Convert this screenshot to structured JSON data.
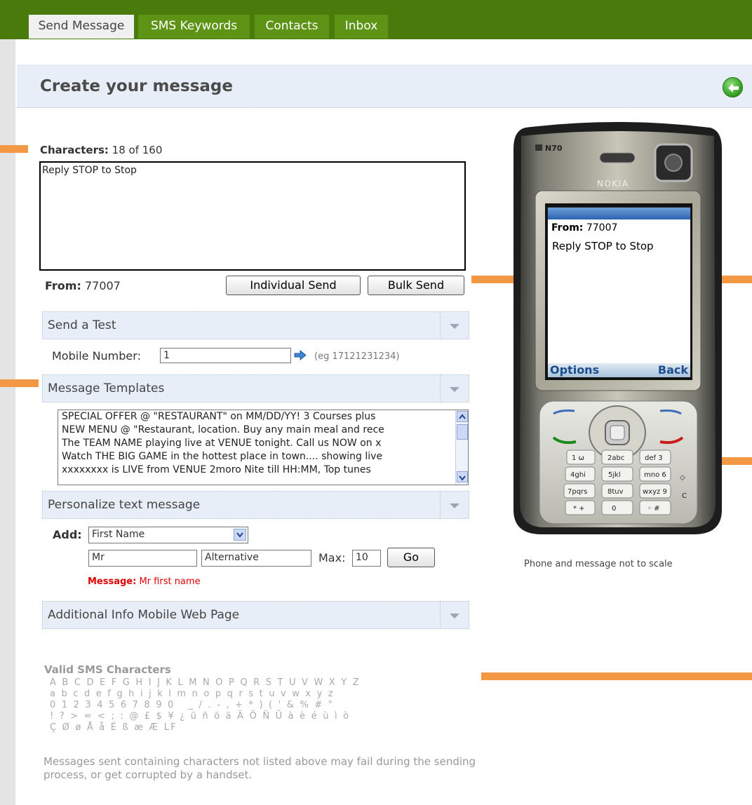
{
  "tabs": [
    {
      "label": "Send Message",
      "active": true
    },
    {
      "label": "SMS Keywords",
      "active": false
    },
    {
      "label": "Contacts",
      "active": false
    },
    {
      "label": "Inbox",
      "active": false
    }
  ],
  "header": {
    "title": "Create your message",
    "back_icon": "back-arrow-icon"
  },
  "compose": {
    "characters_label": "Characters:",
    "characters_count": "18 of 160",
    "message_text": "Reply STOP to Stop",
    "from_label": "From:",
    "from_value": "77007",
    "individual_send_label": "Individual Send",
    "bulk_send_label": "Bulk Send"
  },
  "send_test": {
    "title": "Send a Test",
    "mobile_label": "Mobile Number:",
    "mobile_value": "1",
    "example": "(eg 17121231234)"
  },
  "templates": {
    "title": "Message Templates",
    "items": [
      "SPECIAL OFFER @ \"RESTAURANT\" on MM/DD/YY! 3 Courses plus",
      "NEW MENU @ \"Restaurant, location. Buy any main meal and rece",
      "The TEAM NAME playing live at VENUE tonight. Call us NOW on x",
      "Watch THE BIG GAME in the hottest place in town.... showing live",
      "xxxxxxxx is LIVE from VENUE 2moro Nite till HH:MM, Top tunes"
    ]
  },
  "personalize": {
    "title": "Personalize text message",
    "add_label": "Add:",
    "field_select": "First Name",
    "prefix_value": "Mr",
    "alternative_value": "Alternative",
    "max_label": "Max:",
    "max_value": "10",
    "go_label": "Go",
    "message_label": "Message:",
    "message_preview": "Mr first name"
  },
  "additional": {
    "title": "Additional Info Mobile Web Page"
  },
  "valid_chars": {
    "title": "Valid SMS Characters",
    "rows": [
      "A B C D E F G H I J K L M N O P Q R S T U V W X Y Z",
      "a b c d e f g h i j k l m n o p q r s t u v w x y z",
      "0 1 2 3 4 5 6 7 8 9 0   _ / . - , + * ) ( ' & % # \"",
      "! ? > = < ; : @ £ $ ¥ ¿ ü ñ ö ä Ä Ö Ñ Ü à è é ù ì ò",
      "Ç Ø ø Å å É ß æ Æ LF"
    ],
    "warning": "Messages sent containing characters not listed above may fail during the sending process, or get corrupted by a handset."
  },
  "phone": {
    "model": "N70",
    "brand": "NOKIA",
    "screen_from_label": "From:",
    "screen_from_value": "77007",
    "screen_message": "Reply STOP to Stop",
    "options_label": "Options",
    "back_label": "Back",
    "caption": "Phone and message not to scale",
    "keys": [
      "1",
      "2abc",
      "def 3",
      "4ghi",
      "5jkl",
      "mno 6",
      "7pqrs",
      "8tuv",
      "wxyz 9",
      "*+",
      "0",
      "#"
    ]
  },
  "colors": {
    "nav_green": "#4a7a0c",
    "tab_green": "#5e9416",
    "accent_orange": "#f39844",
    "panel_blue": "#e8eef7",
    "error_red": "#e00000"
  }
}
